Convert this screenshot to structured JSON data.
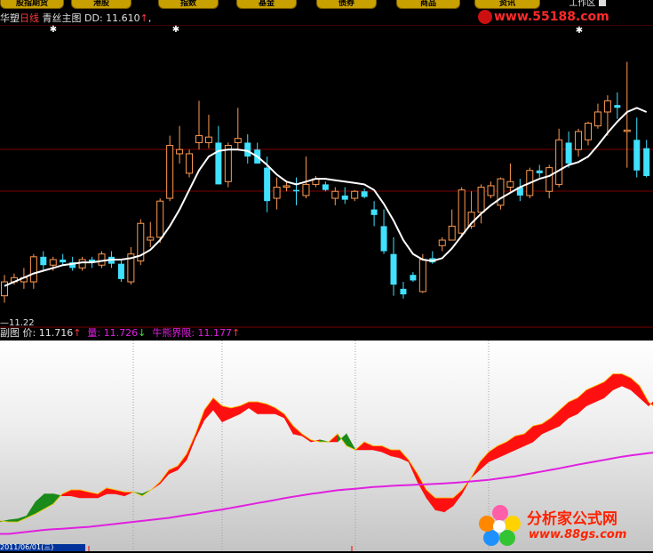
{
  "menu": {
    "tabs": [
      "股指期货",
      "港股",
      "指数",
      "基金",
      "债券",
      "商品",
      "资讯"
    ],
    "workspace": "工作区"
  },
  "watermark_top": "www.55188.com",
  "main_header": {
    "stock": "华塑",
    "period": "日线",
    "indicator": "青丝主图",
    "dd_label": "DD: 11.610",
    "dd_arrow": "↑",
    "tail": ","
  },
  "price_low_label": "—11.22",
  "sub_header": {
    "label": "副图",
    "price_label": "价: 11.716",
    "price_arrow": "↑",
    "volume_label": "量: 11.726",
    "volume_arrow": "↓",
    "bull_label": "牛熊界限: 11.177",
    "bull_arrow": "↑"
  },
  "bottom_date": "2011/06/01(三)",
  "logo": {
    "brand": "分析家公式网",
    "url": "www.88gs.com"
  },
  "colors": {
    "up": "#ff9a50",
    "down": "#40e0ff",
    "ma": "#ffffff",
    "grid": "#7a0000",
    "sub_red": "#ff1010",
    "sub_green": "#1a8a1a",
    "sub_magenta": "#e020e0"
  },
  "chart_data": [
    {
      "type": "candlestick",
      "ylim": [
        11.0,
        13.12
      ],
      "candles": [
        [
          11.2,
          11.35,
          11.15,
          11.3
        ],
        [
          11.3,
          11.36,
          11.28,
          11.33
        ],
        [
          11.3,
          11.4,
          11.25,
          11.33
        ],
        [
          11.3,
          11.5,
          11.25,
          11.48
        ],
        [
          11.48,
          11.52,
          11.38,
          11.42
        ],
        [
          11.42,
          11.48,
          11.38,
          11.46
        ],
        [
          11.46,
          11.5,
          11.42,
          11.44
        ],
        [
          11.44,
          11.48,
          11.38,
          11.4
        ],
        [
          11.4,
          11.48,
          11.38,
          11.46
        ],
        [
          11.46,
          11.48,
          11.4,
          11.44
        ],
        [
          11.42,
          11.52,
          11.4,
          11.5
        ],
        [
          11.48,
          11.52,
          11.4,
          11.43
        ],
        [
          11.43,
          11.46,
          11.3,
          11.32
        ],
        [
          11.3,
          11.55,
          11.28,
          11.5
        ],
        [
          11.45,
          11.75,
          11.42,
          11.72
        ],
        [
          11.6,
          11.73,
          11.55,
          11.62
        ],
        [
          11.62,
          11.9,
          11.58,
          11.88
        ],
        [
          11.9,
          12.35,
          11.88,
          12.28
        ],
        [
          12.22,
          12.42,
          12.15,
          12.25
        ],
        [
          12.08,
          12.25,
          12.05,
          12.22
        ],
        [
          12.3,
          12.6,
          12.25,
          12.35
        ],
        [
          12.3,
          12.5,
          12.26,
          12.34
        ],
        [
          12.3,
          12.42,
          12.0,
          12.0
        ],
        [
          12.02,
          12.3,
          11.98,
          12.28
        ],
        [
          12.3,
          12.55,
          12.25,
          12.33
        ],
        [
          12.3,
          12.36,
          12.15,
          12.2
        ],
        [
          12.25,
          12.3,
          12.15,
          12.15
        ],
        [
          12.12,
          12.2,
          11.8,
          11.88
        ],
        [
          11.9,
          12.05,
          11.82,
          11.98
        ],
        [
          11.98,
          12.02,
          11.95,
          11.99
        ],
        [
          11.96,
          12.05,
          11.85,
          11.95
        ],
        [
          11.92,
          12.2,
          11.9,
          12.0
        ],
        [
          12.0,
          12.06,
          11.98,
          12.04
        ],
        [
          12.0,
          12.02,
          11.95,
          11.96
        ],
        [
          11.9,
          11.98,
          11.85,
          11.95
        ],
        [
          11.92,
          11.98,
          11.86,
          11.89
        ],
        [
          11.9,
          11.96,
          11.88,
          11.95
        ],
        [
          11.95,
          11.97,
          11.9,
          11.91
        ],
        [
          11.82,
          11.88,
          11.7,
          11.78
        ],
        [
          11.7,
          11.82,
          11.5,
          11.52
        ],
        [
          11.5,
          11.62,
          11.2,
          11.28
        ],
        [
          11.25,
          11.3,
          11.18,
          11.21
        ],
        [
          11.35,
          11.37,
          11.3,
          11.31
        ],
        [
          11.23,
          11.5,
          11.22,
          11.46
        ],
        [
          11.47,
          11.52,
          11.43,
          11.44
        ],
        [
          11.56,
          11.62,
          11.52,
          11.6
        ],
        [
          11.6,
          11.82,
          11.6,
          11.7
        ],
        [
          11.65,
          11.98,
          11.62,
          11.96
        ],
        [
          11.7,
          11.95,
          11.68,
          11.8
        ],
        [
          11.8,
          12.0,
          11.72,
          11.98
        ],
        [
          11.92,
          12.02,
          11.9,
          11.99
        ],
        [
          11.85,
          12.05,
          11.82,
          12.04
        ],
        [
          11.98,
          12.15,
          11.95,
          12.02
        ],
        [
          11.98,
          12.04,
          11.88,
          11.92
        ],
        [
          11.92,
          12.12,
          11.9,
          12.1
        ],
        [
          12.1,
          12.14,
          12.05,
          12.08
        ],
        [
          11.95,
          12.14,
          11.9,
          12.12
        ],
        [
          12.0,
          12.4,
          11.98,
          12.32
        ],
        [
          12.3,
          12.38,
          12.12,
          12.15
        ],
        [
          12.25,
          12.4,
          12.2,
          12.38
        ],
        [
          12.32,
          12.45,
          12.28,
          12.44
        ],
        [
          12.42,
          12.58,
          12.4,
          12.52
        ],
        [
          12.52,
          12.64,
          12.35,
          12.6
        ],
        [
          12.57,
          12.66,
          12.47,
          12.55
        ],
        [
          12.39,
          12.88,
          12.12,
          12.39
        ],
        [
          12.32,
          12.48,
          12.05,
          12.1
        ],
        [
          12.26,
          12.32,
          12.05,
          12.06
        ]
      ],
      "ma": [
        11.27,
        11.3,
        11.33,
        11.36,
        11.38,
        11.4,
        11.42,
        11.43,
        11.44,
        11.44,
        11.45,
        11.46,
        11.46,
        11.47,
        11.49,
        11.53,
        11.6,
        11.7,
        11.82,
        11.96,
        12.1,
        12.2,
        12.24,
        12.25,
        12.25,
        12.24,
        12.2,
        12.14,
        12.07,
        12.02,
        12.0,
        12.02,
        12.04,
        12.04,
        12.03,
        12.02,
        12.01,
        12.0,
        11.96,
        11.86,
        11.74,
        11.6,
        11.5,
        11.46,
        11.45,
        11.47,
        11.54,
        11.63,
        11.72,
        11.79,
        11.85,
        11.9,
        11.94,
        11.98,
        12.01,
        12.04,
        12.06,
        12.1,
        12.14,
        12.16,
        12.2,
        12.28,
        12.37,
        12.45,
        12.52,
        12.55,
        12.52
      ]
    },
    {
      "type": "area",
      "title": "副图",
      "ylim": [
        0,
        1
      ],
      "x": [
        0,
        10,
        20,
        30,
        40,
        50,
        60,
        70,
        80,
        90,
        100,
        110,
        120,
        130,
        140,
        150,
        160,
        170,
        180,
        190,
        200,
        210,
        220,
        230,
        240,
        250,
        260,
        270,
        280,
        290,
        300,
        310,
        320,
        330,
        340,
        350,
        360,
        370,
        380,
        390,
        400,
        410,
        420,
        430,
        440,
        450,
        460,
        470,
        480,
        490,
        500,
        510,
        520,
        530,
        540,
        550,
        560,
        570,
        580,
        590,
        600,
        610,
        620,
        630,
        640,
        650,
        660,
        670,
        680,
        690,
        700,
        710,
        720,
        730,
        735
      ],
      "series": [
        {
          "name": "价",
          "values": [
            0.125,
            0.12,
            0.12,
            0.14,
            0.16,
            0.185,
            0.21,
            0.26,
            0.28,
            0.28,
            0.27,
            0.26,
            0.29,
            0.28,
            0.27,
            0.27,
            0.25,
            0.28,
            0.32,
            0.38,
            0.4,
            0.46,
            0.56,
            0.68,
            0.74,
            0.7,
            0.69,
            0.7,
            0.72,
            0.72,
            0.71,
            0.69,
            0.66,
            0.6,
            0.56,
            0.53,
            0.52,
            0.52,
            0.56,
            0.5,
            0.48,
            0.52,
            0.5,
            0.5,
            0.48,
            0.48,
            0.43,
            0.36,
            0.28,
            0.24,
            0.24,
            0.24,
            0.28,
            0.34,
            0.42,
            0.47,
            0.5,
            0.52,
            0.55,
            0.56,
            0.6,
            0.61,
            0.64,
            0.68,
            0.72,
            0.74,
            0.78,
            0.8,
            0.82,
            0.86,
            0.86,
            0.84,
            0.8,
            0.72,
            0.7
          ]
        },
        {
          "name": "量",
          "values": [
            0.12,
            0.13,
            0.135,
            0.15,
            0.22,
            0.26,
            0.26,
            0.25,
            0.25,
            0.24,
            0.24,
            0.24,
            0.26,
            0.26,
            0.25,
            0.27,
            0.26,
            0.28,
            0.31,
            0.36,
            0.38,
            0.43,
            0.54,
            0.63,
            0.68,
            0.62,
            0.64,
            0.66,
            0.69,
            0.66,
            0.66,
            0.66,
            0.64,
            0.56,
            0.55,
            0.52,
            0.53,
            0.52,
            0.52,
            0.56,
            0.48,
            0.48,
            0.48,
            0.47,
            0.45,
            0.44,
            0.42,
            0.32,
            0.24,
            0.18,
            0.17,
            0.2,
            0.26,
            0.34,
            0.38,
            0.42,
            0.44,
            0.46,
            0.48,
            0.5,
            0.52,
            0.56,
            0.58,
            0.6,
            0.64,
            0.66,
            0.7,
            0.72,
            0.74,
            0.78,
            0.8,
            0.78,
            0.74,
            0.7,
            0.72
          ]
        },
        {
          "name": "牛熊界限",
          "values": [
            0.06,
            0.06,
            0.065,
            0.07,
            0.075,
            0.08,
            0.083,
            0.086,
            0.089,
            0.092,
            0.095,
            0.1,
            0.105,
            0.11,
            0.115,
            0.12,
            0.125,
            0.13,
            0.135,
            0.14,
            0.147,
            0.154,
            0.16,
            0.168,
            0.175,
            0.182,
            0.19,
            0.198,
            0.206,
            0.214,
            0.222,
            0.23,
            0.238,
            0.246,
            0.253,
            0.26,
            0.266,
            0.272,
            0.278,
            0.282,
            0.286,
            0.29,
            0.294,
            0.297,
            0.3,
            0.302,
            0.304,
            0.306,
            0.308,
            0.31,
            0.312,
            0.315,
            0.318,
            0.322,
            0.326,
            0.33,
            0.336,
            0.342,
            0.348,
            0.356,
            0.364,
            0.372,
            0.38,
            0.388,
            0.397,
            0.406,
            0.414,
            0.422,
            0.43,
            0.438,
            0.446,
            0.452,
            0.458,
            0.464,
            0.466
          ]
        }
      ]
    }
  ]
}
